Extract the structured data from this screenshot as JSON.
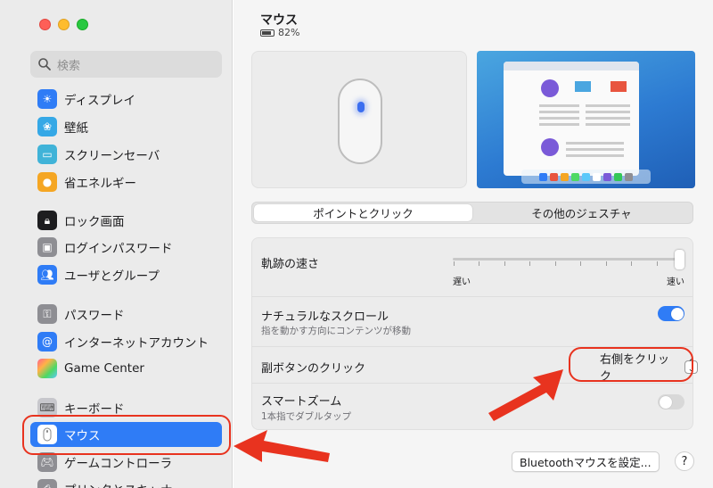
{
  "sidebar": {
    "search_placeholder": "検索",
    "items": [
      {
        "label": "ディスプレイ",
        "icon": "display-icon"
      },
      {
        "label": "壁紙",
        "icon": "wallpaper-icon"
      },
      {
        "label": "スクリーンセーバ",
        "icon": "screensaver-icon"
      },
      {
        "label": "省エネルギー",
        "icon": "energy-bulb-icon"
      },
      {
        "label": "ロック画面",
        "icon": "lock-screen-icon"
      },
      {
        "label": "ログインパスワード",
        "icon": "login-password-icon"
      },
      {
        "label": "ユーザとグループ",
        "icon": "users-groups-icon"
      },
      {
        "label": "パスワード",
        "icon": "key-icon"
      },
      {
        "label": "インターネットアカウント",
        "icon": "at-icon"
      },
      {
        "label": "Game Center",
        "icon": "game-center-icon"
      },
      {
        "label": "キーボード",
        "icon": "keyboard-icon"
      },
      {
        "label": "マウス",
        "icon": "mouse-icon",
        "selected": true
      },
      {
        "label": "ゲームコントローラ",
        "icon": "game-controller-icon"
      },
      {
        "label": "プリンタとスキャナ",
        "icon": "printer-icon"
      }
    ]
  },
  "main": {
    "title": "マウス",
    "battery": "82%",
    "tabs": [
      {
        "label": "ポイントとクリック",
        "active": true
      },
      {
        "label": "その他のジェスチャ",
        "active": false
      }
    ],
    "tracking": {
      "label": "軌跡の速さ",
      "slow": "遅い",
      "fast": "速い",
      "level": 1.0
    },
    "natural_scroll": {
      "label": "ナチュラルなスクロール",
      "sub": "指を動かす方向にコンテンツが移動",
      "on": true
    },
    "secondary_click": {
      "label": "副ボタンのクリック",
      "value": "右側をクリック"
    },
    "smart_zoom": {
      "label": "スマートズーム",
      "sub": "1本指でダブルタップ",
      "on": false
    },
    "bluetooth_button": "Bluetoothマウスを設定...",
    "help": "?"
  },
  "colors": {
    "accent": "#2f7cf6",
    "annotation": "#e8331f"
  }
}
